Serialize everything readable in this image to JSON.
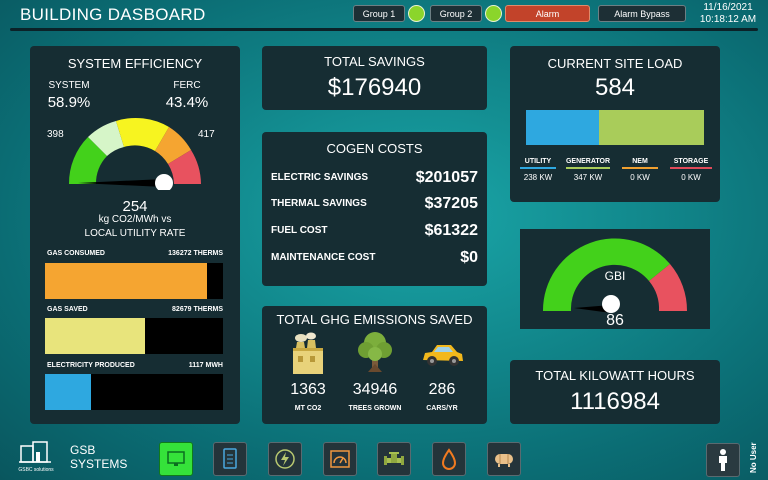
{
  "header": {
    "title": "BUILDING DASBOARD",
    "group1_label": "Group 1",
    "group2_label": "Group 2",
    "alarm_label": "Alarm",
    "alarm_bypass_label": "Alarm Bypass",
    "date": "11/16/2021",
    "time": "10:18:12 AM"
  },
  "system_efficiency": {
    "title": "SYSTEM EFFICIENCY",
    "system_label": "SYSTEM",
    "system_value": "58.9%",
    "ferc_label": "FERC",
    "ferc_value": "43.4%",
    "gauge_min": "398",
    "gauge_max": "417",
    "gauge_value": "254",
    "gauge_caption_1": "kg CO2/MWh vs",
    "gauge_caption_2": "LOCAL UTILITY RATE",
    "gas_consumed_label": "GAS CONSUMED",
    "gas_consumed_value": "136272 THERMS",
    "gas_consumed_fill": 0.91,
    "gas_saved_label": "GAS SAVED",
    "gas_saved_value": "82679 THERMS",
    "gas_saved_fill": 0.56,
    "electricity_label": "ELECTRICITY PRODUCED",
    "electricity_value": "1117 MWH",
    "electricity_fill": 0.26
  },
  "total_savings": {
    "title": "TOTAL SAVINGS",
    "value": "$176940"
  },
  "cogen_costs": {
    "title": "COGEN COSTS",
    "rows": [
      {
        "label": "ELECTRIC SAVINGS",
        "value": "$201057"
      },
      {
        "label": "THERMAL SAVINGS",
        "value": "$37205"
      },
      {
        "label": "FUEL COST",
        "value": "$61322"
      },
      {
        "label": "MAINTENANCE COST",
        "value": "$0"
      }
    ]
  },
  "ghg": {
    "title": "TOTAL GHG EMISSIONS SAVED",
    "items": [
      {
        "icon": "factory-icon",
        "value": "1363",
        "label": "MT CO2"
      },
      {
        "icon": "tree-icon",
        "value": "34946",
        "label": "TREES GROWN"
      },
      {
        "icon": "car-icon",
        "value": "286",
        "label": "CARS/YR"
      }
    ]
  },
  "site_load": {
    "title": "CURRENT SITE LOAD",
    "value": "584",
    "utility_share": 0.41,
    "generator_share": 0.59,
    "legend": [
      {
        "label": "UTILITY",
        "value": "238 KW",
        "color": "#2ea8e0"
      },
      {
        "label": "GENERATOR",
        "value": "347 KW",
        "color": "#a9cc5a"
      },
      {
        "label": "NEM",
        "value": "0 KW",
        "color": "#f0a030"
      },
      {
        "label": "STORAGE",
        "value": "0 KW",
        "color": "#e04a5a"
      }
    ]
  },
  "gbi": {
    "label": "GBI",
    "value": "86"
  },
  "total_kwh": {
    "title": "TOTAL KILOWATT HOURS",
    "value": "1116984"
  },
  "footer": {
    "brand_small": "GSBC solutions",
    "brand_line1": "GSB",
    "brand_line2": "SYSTEMS",
    "user_label": "No User",
    "nav_icons": [
      "monitor-icon",
      "document-icon",
      "power-icon",
      "gauge-icon",
      "valve-icon",
      "flame-icon",
      "tank-icon"
    ]
  },
  "colors": {
    "gas_consumed": "#f5a531",
    "gas_saved": "#e8e47c",
    "electricity": "#2ea8e0",
    "gauge_green": "#43d11b",
    "gauge_red": "#e8525f",
    "alarm": "#c2432a"
  }
}
